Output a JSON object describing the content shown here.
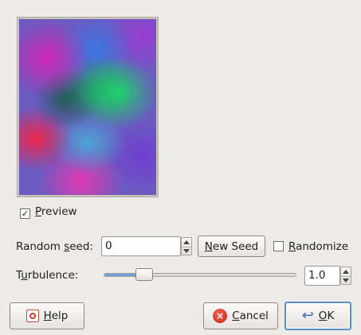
{
  "preview": {
    "checked": true,
    "label": "Preview",
    "mnemonic": "P",
    "rest": "review"
  },
  "random_seed": {
    "label_pre": "Random ",
    "label_mn": "s",
    "label_post": "eed:",
    "value": "0",
    "new_seed_mn": "N",
    "new_seed_rest": "ew Seed",
    "randomize_mn": "R",
    "randomize_rest": "andomize",
    "randomize_checked": false
  },
  "turbulence": {
    "label_pre": "T",
    "label_mn": "u",
    "label_post": "rbulence:",
    "value": "1.0",
    "level_fraction": 0.18
  },
  "buttons": {
    "help_mn": "H",
    "help_rest": "elp",
    "cancel_mn": "C",
    "cancel_rest": "ancel",
    "ok_mn": "O",
    "ok_rest": "K"
  },
  "icons": {
    "help": "help-icon",
    "cancel": "cancel-icon",
    "ok": "ok-icon",
    "check": "checkmark-icon"
  }
}
